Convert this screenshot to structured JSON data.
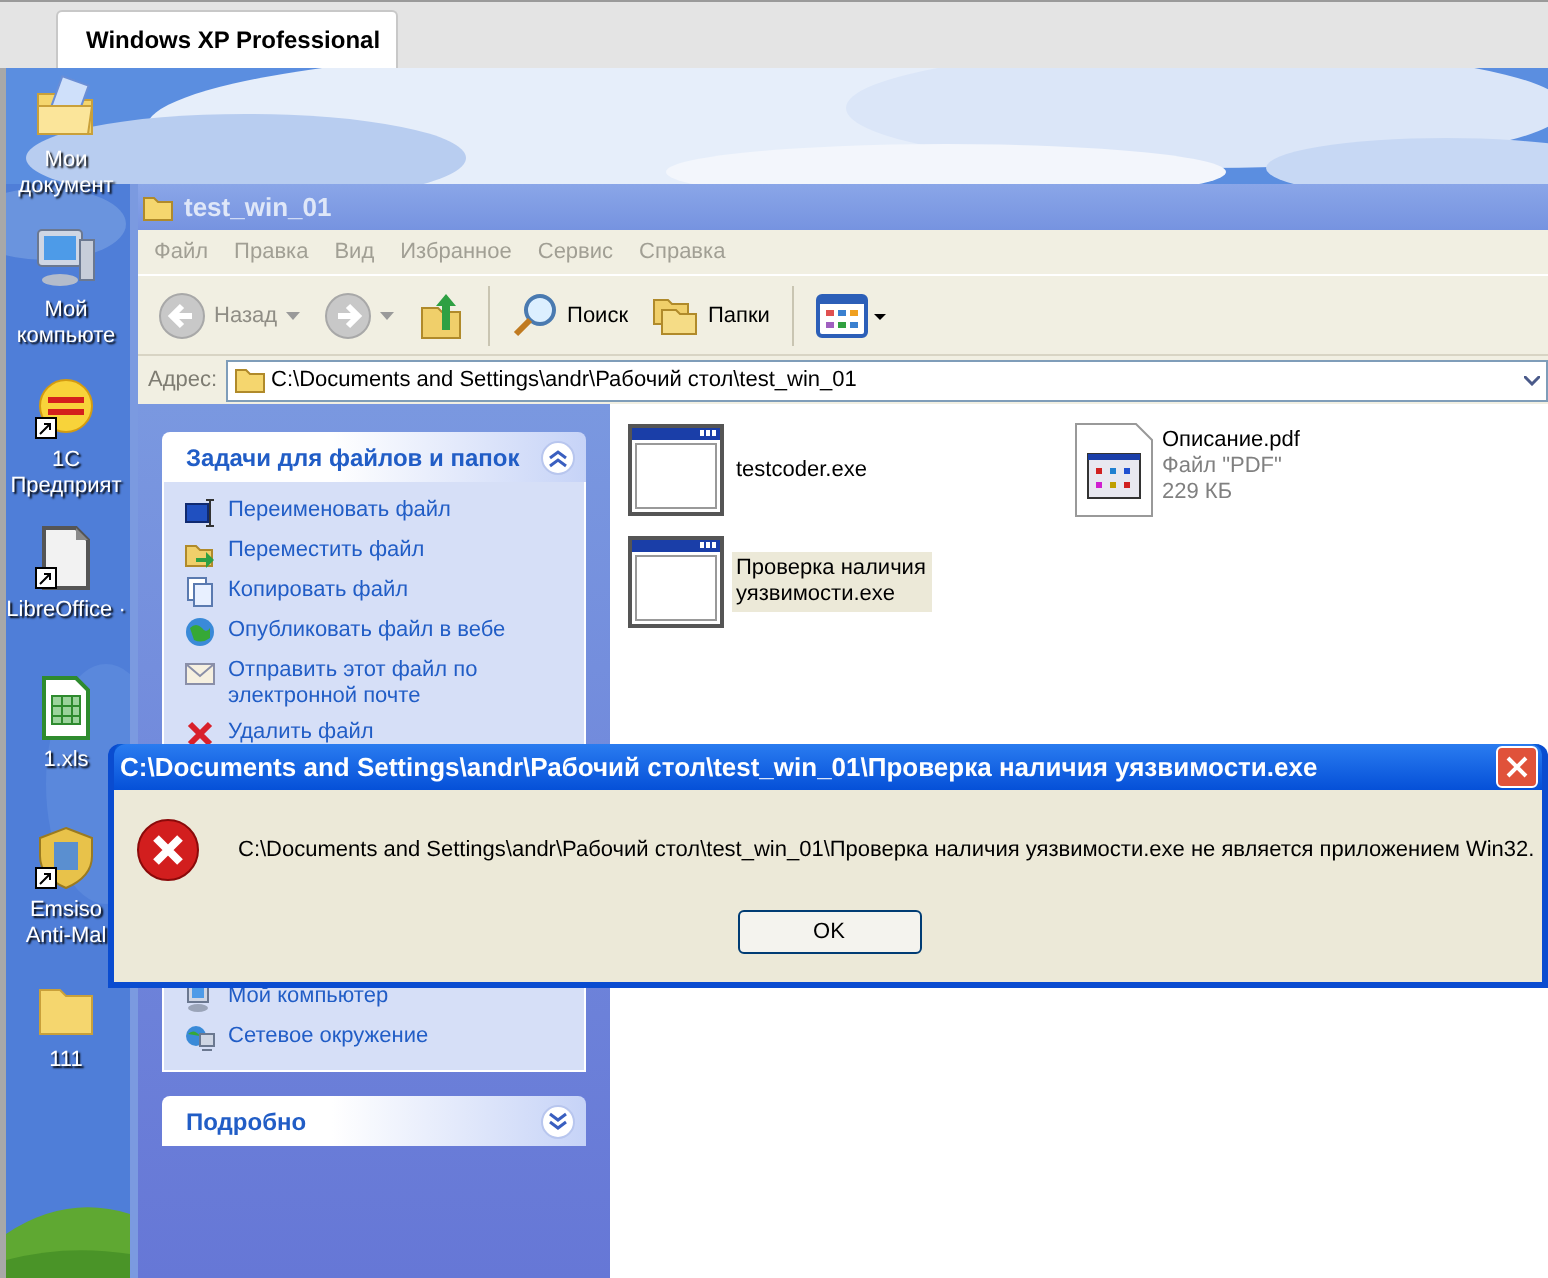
{
  "host_tab": {
    "title": "Windows XP Professional",
    "selected": true
  },
  "desktop_icons": [
    {
      "kind": "documents",
      "label": "Мои документ",
      "shortcut": false
    },
    {
      "kind": "computer",
      "label": "Мой компьюте",
      "shortcut": false
    },
    {
      "kind": "onec",
      "label": "1С Предприят",
      "shortcut": true
    },
    {
      "kind": "libreoffice",
      "label": "LibreOffice ·",
      "shortcut": true
    },
    {
      "kind": "spreadsheet",
      "label": "1.xls",
      "shortcut": false
    },
    {
      "kind": "shield",
      "label": "Emsiso Anti-Mal",
      "shortcut": true
    },
    {
      "kind": "folder",
      "label": "111",
      "shortcut": false
    }
  ],
  "explorer": {
    "title": "test_win_01",
    "menu": [
      "Файл",
      "Правка",
      "Вид",
      "Избранное",
      "Сервис",
      "Справка"
    ],
    "toolbar": [
      {
        "kind": "back",
        "label": "Назад",
        "disabled": true
      },
      {
        "kind": "forward",
        "disabled": true
      },
      {
        "kind": "up",
        "disabled": false
      },
      {
        "kind": "search",
        "label": "Поиск",
        "disabled": false
      },
      {
        "kind": "folders",
        "label": "Папки",
        "disabled": false
      },
      {
        "kind": "views",
        "disabled": false
      }
    ],
    "address": {
      "label": "Адрес:",
      "value": "C:\\Documents and Settings\\andr\\Рабочий стол\\test_win_01"
    },
    "tasks_panel": {
      "title": "Задачи для файлов и папок",
      "expanded": true,
      "items": [
        {
          "kind": "rename",
          "label": "Переименовать файл"
        },
        {
          "kind": "move",
          "label": "Переместить файл"
        },
        {
          "kind": "copy",
          "label": "Копировать файл"
        },
        {
          "kind": "publish",
          "label": "Опубликовать файл в вебе"
        },
        {
          "kind": "email",
          "label": "Отправить этот файл по электронной почте"
        },
        {
          "kind": "delete",
          "label": "Удалить файл"
        }
      ]
    },
    "places_panel": {
      "items": [
        {
          "kind": "computer",
          "label": "Мой компьютер"
        },
        {
          "kind": "network",
          "label": "Сетевое окружение"
        }
      ]
    },
    "details_panel": {
      "title": "Подробно",
      "expanded": false
    },
    "files": [
      {
        "kind": "exe",
        "name": "testcoder.exe",
        "selected": false
      },
      {
        "kind": "pdf",
        "name": "Описание.pdf",
        "type": "Файл \"PDF\"",
        "size": "229 КБ",
        "selected": false
      },
      {
        "kind": "exe",
        "name": "Проверка наличия уязвимости.exe",
        "selected": true
      }
    ]
  },
  "dialog": {
    "title": "C:\\Documents and Settings\\andr\\Рабочий стол\\test_win_01\\Проверка наличия уязвимости.exe",
    "message": "C:\\Documents and Settings\\andr\\Рабочий стол\\test_win_01\\Проверка наличия уязвимости.exe не является приложением Win32.",
    "button": "OK"
  }
}
